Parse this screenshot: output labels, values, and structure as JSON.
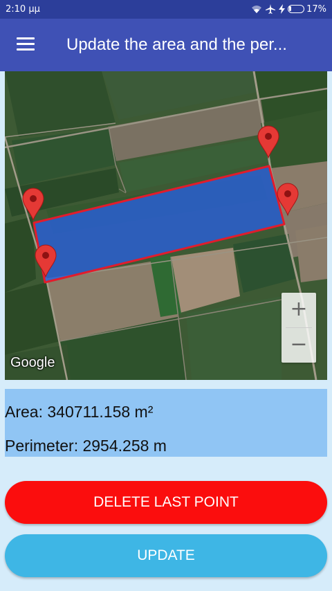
{
  "status_bar": {
    "time": "2:10 μμ",
    "battery_text": "17%",
    "battery_level_percent": 17
  },
  "app_bar": {
    "title": "Update the area and the per..."
  },
  "map": {
    "attribution": "Google",
    "zoom_in_label": "+",
    "zoom_out_label": "−"
  },
  "info": {
    "area": "Area: 340711.158 m²",
    "perimeter": "Perimeter: 2954.258 m"
  },
  "buttons": {
    "delete_last_point": "DELETE LAST POINT",
    "update": "UPDATE"
  },
  "colors": {
    "status_bar": "#2c3e9a",
    "app_bar": "#3f51b5",
    "polygon_fill": "#2a5fd8",
    "polygon_stroke": "#e21c2c",
    "marker": "#e53935",
    "delete_button": "#fb0d0d",
    "update_button": "#3eb6e5",
    "info_panel": "#90c5f4",
    "background": "#d6ecfa"
  }
}
